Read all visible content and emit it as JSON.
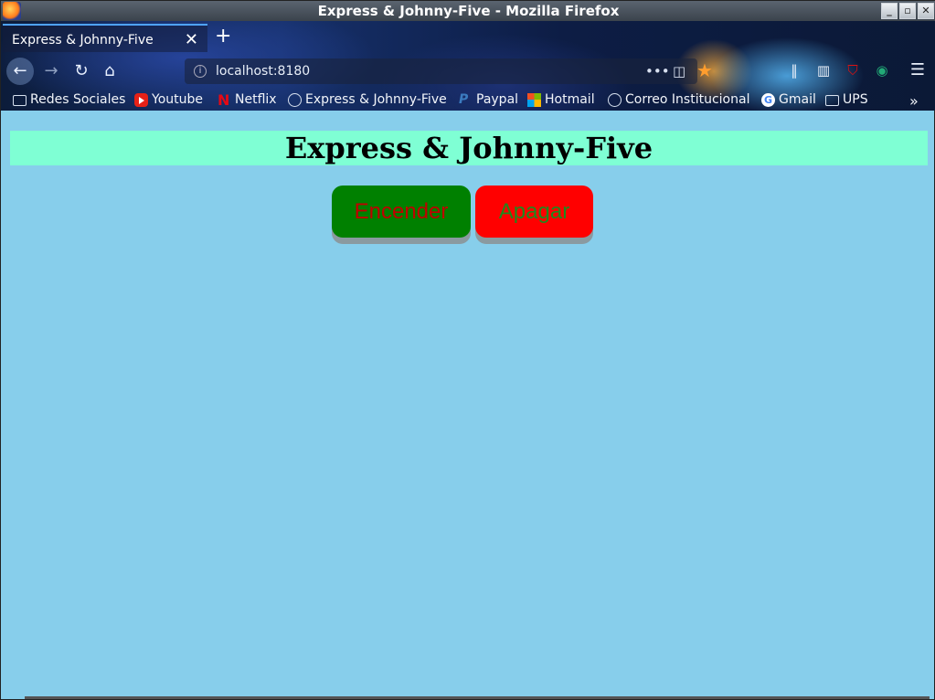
{
  "window": {
    "title": "Express & Johnny-Five - Mozilla Firefox"
  },
  "tab": {
    "label": "Express & Johnny-Five",
    "close": "✕",
    "new_tab": "+"
  },
  "nav": {
    "url": "localhost:8180",
    "more": "•••"
  },
  "bookmarks": [
    {
      "label": "Redes Sociales",
      "icon": "folder-icon"
    },
    {
      "label": "Youtube",
      "icon": "youtube-icon"
    },
    {
      "label": "Netflix",
      "icon": "netflix-icon"
    },
    {
      "label": "Express & Johnny-Five",
      "icon": "globe-icon"
    },
    {
      "label": "Paypal",
      "icon": "paypal-icon"
    },
    {
      "label": "Hotmail",
      "icon": "microsoft-icon"
    },
    {
      "label": "Correo Institucional",
      "icon": "globe-icon"
    },
    {
      "label": "Gmail",
      "icon": "google-icon"
    },
    {
      "label": "UPS",
      "icon": "folder-icon"
    }
  ],
  "page": {
    "heading": "Express & Johnny-Five",
    "on_button": "Encender",
    "off_button": "Apagar"
  },
  "colors": {
    "page_bg": "#87ceeb",
    "heading_bg": "#7fffd4",
    "on_button_bg": "#008000",
    "on_button_text": "#c00000",
    "off_button_bg": "#ff0000",
    "off_button_text": "#1e8a1e"
  }
}
